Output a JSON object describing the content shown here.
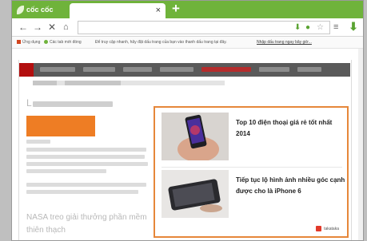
{
  "browser": {
    "brand": "cốc cốc",
    "tab_close": "×",
    "new_tab": "+",
    "nav": {
      "back": "←",
      "forward": "→",
      "stop": "✕",
      "home": "⌂"
    },
    "download_icon": "download-icon"
  },
  "bookmarks": {
    "apps": "Ứng dụng",
    "recent": "Các tab mới đóng",
    "hint": "Để truy cập nhanh, hãy đặt dấu trang của bạn vào thanh dấu trang tại đây.",
    "import": "Nhập dấu trang ngay bây giờ..."
  },
  "page": {
    "headline_1": "L",
    "headline_2": "NASA treo giải thưởng phần mềm",
    "headline_3": "thiên thạch"
  },
  "ad": {
    "items": [
      {
        "text": "Top 10 điện thoại giá rẻ tốt nhất 2014"
      },
      {
        "text": "Tiếp tục lộ hình ảnh nhiều góc cạnh được cho là iPhone 6"
      }
    ],
    "footer": "takataka"
  },
  "colors": {
    "accent_green": "#6fb33b",
    "ad_border": "#e6873a",
    "orange_block": "#ee7d24",
    "nav_dark": "#5a5a5a",
    "nav_red": "#b30f0f"
  }
}
